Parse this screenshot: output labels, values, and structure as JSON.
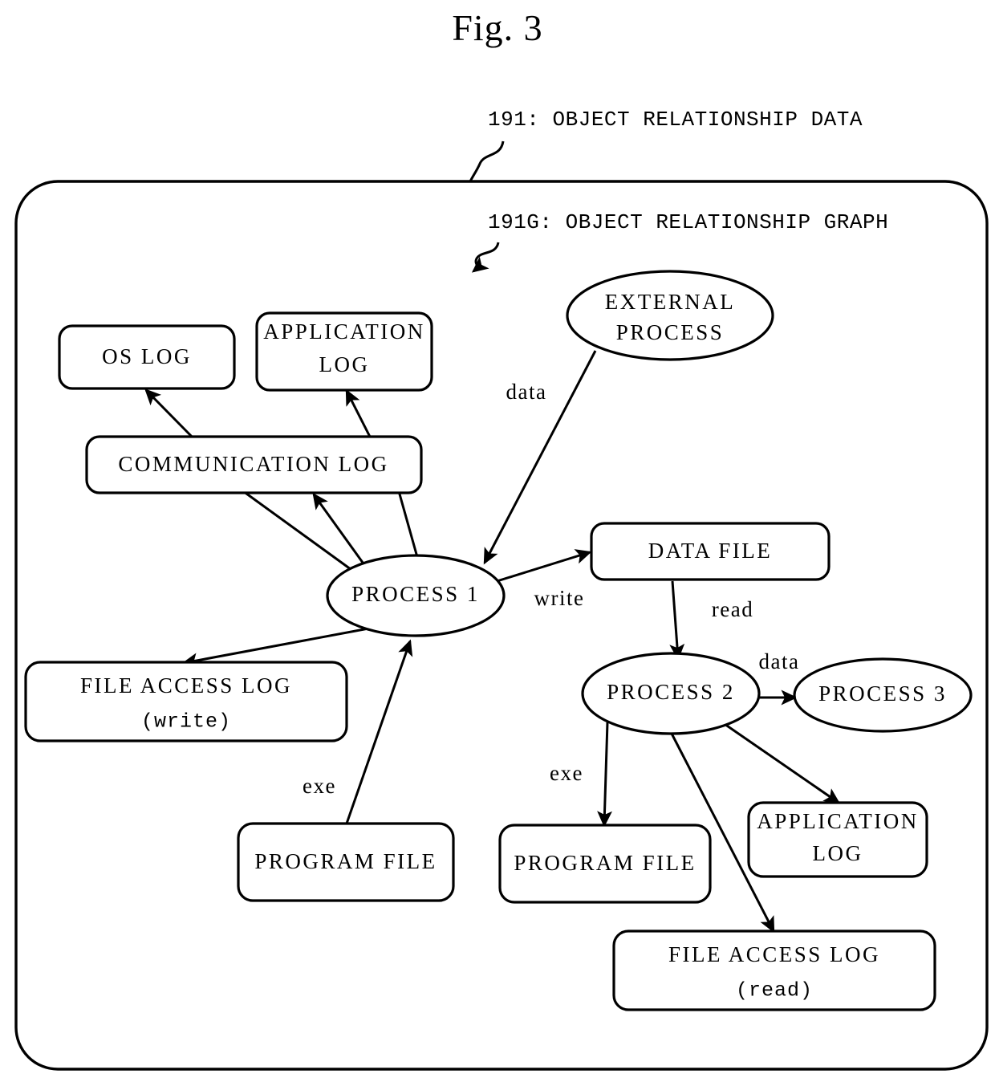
{
  "figure": {
    "title": "Fig. 3"
  },
  "callouts": [
    {
      "id": "191",
      "text": "191: OBJECT RELATIONSHIP DATA"
    },
    {
      "id": "191G",
      "text": "191G: OBJECT RELATIONSHIP GRAPH"
    }
  ],
  "chart_data": {
    "type": "diagram",
    "title": "Fig. 3",
    "container_label": "191: OBJECT RELATIONSHIP DATA",
    "graph_label": "191G: OBJECT RELATIONSHIP GRAPH",
    "nodes": [
      {
        "id": "os-log",
        "shape": "box",
        "label": "OS LOG",
        "label2": ""
      },
      {
        "id": "application-log-1",
        "shape": "box",
        "label": "APPLICATION",
        "label2": "LOG"
      },
      {
        "id": "communication-log",
        "shape": "box",
        "label": "COMMUNICATION LOG",
        "label2": ""
      },
      {
        "id": "external-process",
        "shape": "ellipse",
        "label": "EXTERNAL",
        "label2": "PROCESS"
      },
      {
        "id": "process-1",
        "shape": "ellipse",
        "label": "PROCESS 1",
        "label2": ""
      },
      {
        "id": "data-file",
        "shape": "box",
        "label": "DATA FILE",
        "label2": ""
      },
      {
        "id": "file-access-log-write",
        "shape": "box",
        "label": "FILE ACCESS LOG",
        "label2": "(write)"
      },
      {
        "id": "process-2",
        "shape": "ellipse",
        "label": "PROCESS 2",
        "label2": ""
      },
      {
        "id": "process-3",
        "shape": "ellipse",
        "label": "PROCESS 3",
        "label2": ""
      },
      {
        "id": "program-file-1",
        "shape": "box",
        "label": "PROGRAM FILE",
        "label2": ""
      },
      {
        "id": "program-file-2",
        "shape": "box",
        "label": "PROGRAM FILE",
        "label2": ""
      },
      {
        "id": "application-log-2",
        "shape": "box",
        "label": "APPLICATION",
        "label2": "LOG"
      },
      {
        "id": "file-access-log-read",
        "shape": "box",
        "label": "FILE ACCESS LOG",
        "label2": "(read)"
      }
    ],
    "edges": [
      {
        "from": "communication-log",
        "to": "os-log",
        "label": ""
      },
      {
        "from": "communication-log",
        "to": "application-log-1",
        "label": ""
      },
      {
        "from": "process-1",
        "to": "communication-log",
        "label": ""
      },
      {
        "from": "external-process",
        "to": "process-1",
        "label": "data"
      },
      {
        "from": "process-1",
        "to": "data-file",
        "label": "write"
      },
      {
        "from": "process-1",
        "to": "file-access-log-write",
        "label": ""
      },
      {
        "from": "program-file-1",
        "to": "process-1",
        "label": "exe"
      },
      {
        "from": "data-file",
        "to": "process-2",
        "label": "read"
      },
      {
        "from": "process-2",
        "to": "process-3",
        "label": "data"
      },
      {
        "from": "process-2",
        "to": "program-file-2",
        "label": "exe"
      },
      {
        "from": "process-2",
        "to": "application-log-2",
        "label": ""
      },
      {
        "from": "process-2",
        "to": "file-access-log-read",
        "label": ""
      }
    ]
  },
  "nodes": {
    "os_log": {
      "line1": "OS LOG",
      "line2": ""
    },
    "application_log_1": {
      "line1": "APPLICATION",
      "line2": "LOG"
    },
    "communication_log": {
      "line1": "COMMUNICATION LOG",
      "line2": ""
    },
    "external_process": {
      "line1": "EXTERNAL",
      "line2": "PROCESS"
    },
    "process_1": {
      "line1": "PROCESS 1",
      "line2": ""
    },
    "data_file": {
      "line1": "DATA FILE",
      "line2": ""
    },
    "file_access_log_write": {
      "line1": "FILE ACCESS LOG",
      "line2": "(write)"
    },
    "process_2": {
      "line1": "PROCESS 2",
      "line2": ""
    },
    "process_3": {
      "line1": "PROCESS 3",
      "line2": ""
    },
    "program_file_1": {
      "line1": "PROGRAM FILE",
      "line2": ""
    },
    "program_file_2": {
      "line1": "PROGRAM FILE",
      "line2": ""
    },
    "application_log_2": {
      "line1": "APPLICATION",
      "line2": "LOG"
    },
    "file_access_log_read": {
      "line1": "FILE ACCESS LOG",
      "line2": "(read)"
    }
  },
  "edge_labels": {
    "data_external": "data",
    "write": "write",
    "read": "read",
    "data_process": "data",
    "exe_left": "exe",
    "exe_right": "exe"
  },
  "colors": {
    "stroke": "#000000",
    "fill": "#ffffff",
    "background": "#ffffff"
  }
}
